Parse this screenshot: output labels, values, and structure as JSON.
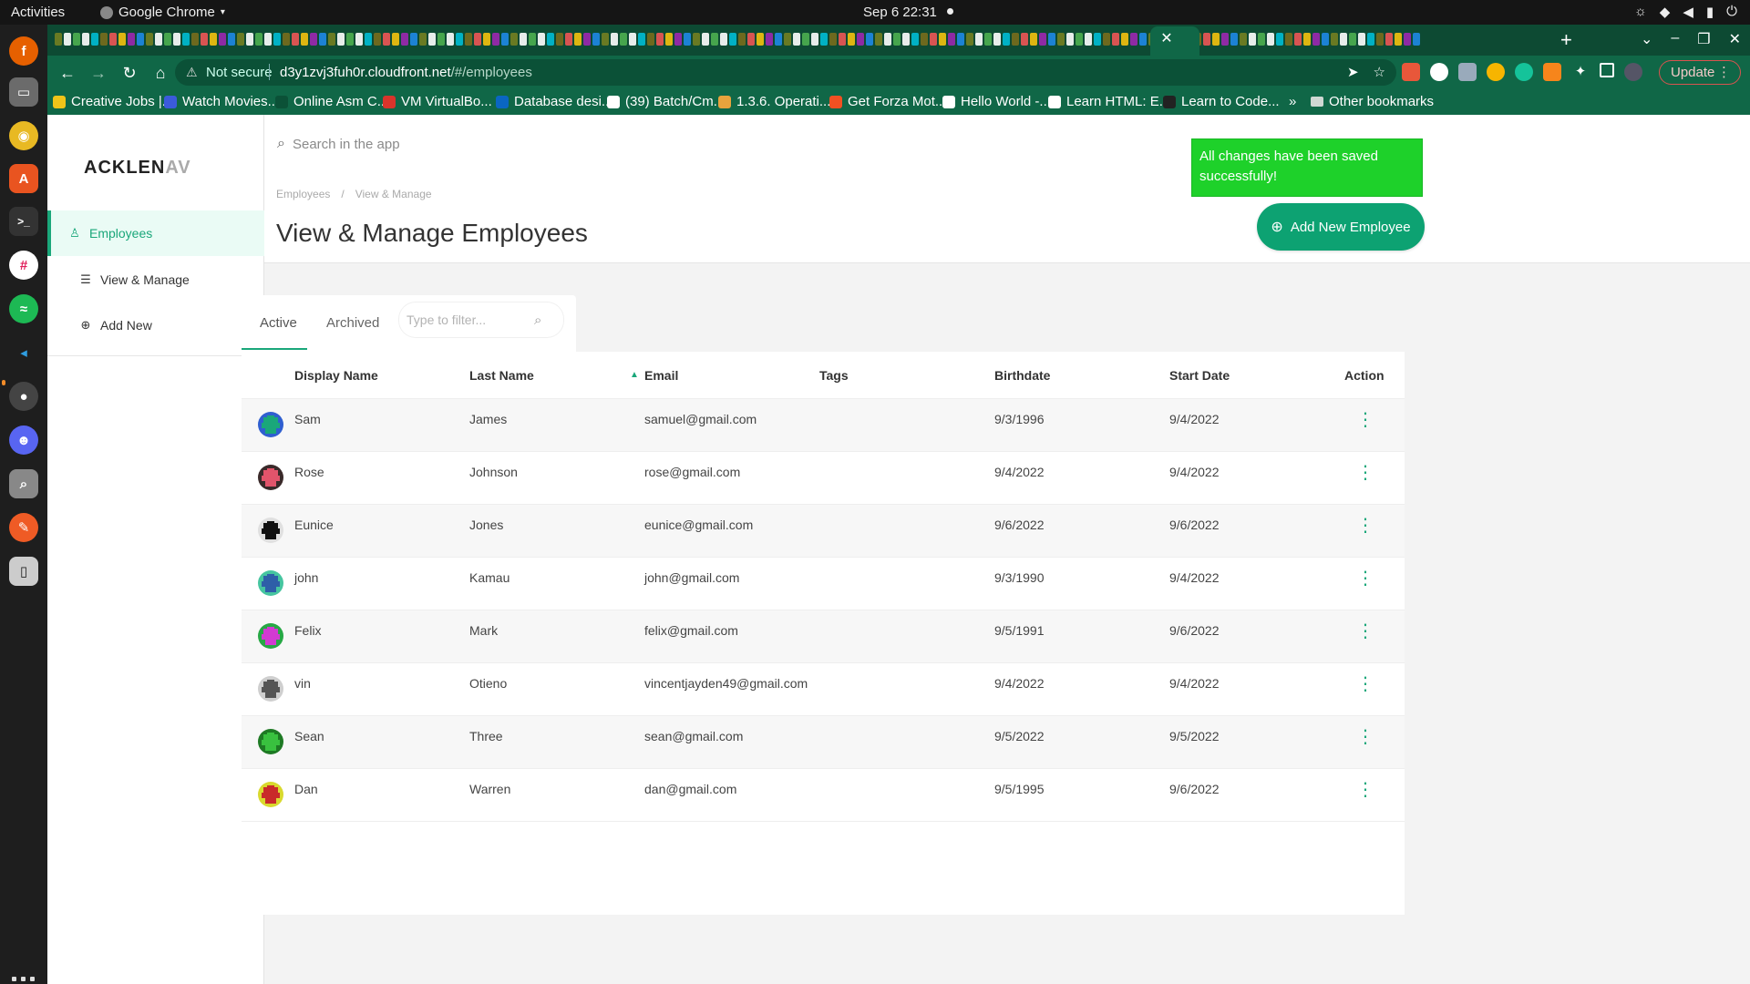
{
  "system": {
    "activities": "Activities",
    "app_name": "Google Chrome",
    "clock": "Sep 6  22:31"
  },
  "browser": {
    "url_warning": "Not secure",
    "url_host": "d3y1zvj3fuh0r.cloudfront.net",
    "url_path": "/#/employees",
    "update_label": "Update",
    "bookmarks": [
      {
        "label": "Creative Jobs |...",
        "color": "#f0c419"
      },
      {
        "label": "Watch Movies...",
        "color": "#3b5bdb"
      },
      {
        "label": "Online Asm C...",
        "color": "#0b5137"
      },
      {
        "label": "VM VirtualBo...",
        "color": "#d9342b"
      },
      {
        "label": "Database desi...",
        "color": "#0a66c2"
      },
      {
        "label": "(39) Batch/Cm...",
        "color": "#ffffff"
      },
      {
        "label": "1.3.6. Operati...",
        "color": "#e8a33d"
      },
      {
        "label": "Get Forza Mot...",
        "color": "#f25022"
      },
      {
        "label": "Hello World -...",
        "color": "#ffffff"
      },
      {
        "label": "Learn HTML: E...",
        "color": "#ffffff"
      },
      {
        "label": "Learn to Code...",
        "color": "#222222"
      }
    ],
    "bookmarks_overflow": "»",
    "other_bookmarks": "Other bookmarks"
  },
  "app": {
    "logo_main": "ACKLEN",
    "logo_fade": "AV",
    "search_placeholder": "Search in the app",
    "nav": {
      "employees": "Employees",
      "view_manage": "View & Manage",
      "add_new": "Add New"
    },
    "breadcrumb": [
      "Employees",
      "/",
      "View & Manage"
    ],
    "page_title": "View & Manage Employees",
    "toast": "All changes have been saved successfully!",
    "add_button": "Add New Employee",
    "tabs": {
      "active": "Active",
      "archived": "Archived"
    },
    "filter_placeholder": "Type to filter...",
    "columns": [
      "Display Name",
      "Last Name",
      "Email",
      "Tags",
      "Birthdate",
      "Start Date",
      "Action"
    ],
    "rows": [
      {
        "display": "Sam",
        "last": "James",
        "email": "samuel@gmail.com",
        "tags": "",
        "birth": "9/3/1996",
        "start": "9/4/2022",
        "c1": "#1aa77a",
        "c2": "#2f5fd0"
      },
      {
        "display": "Rose",
        "last": "Johnson",
        "email": "rose@gmail.com",
        "tags": "",
        "birth": "9/4/2022",
        "start": "9/4/2022",
        "c1": "#e2546b",
        "c2": "#3a2a2a"
      },
      {
        "display": "Eunice",
        "last": "Jones",
        "email": "eunice@gmail.com",
        "tags": "",
        "birth": "9/6/2022",
        "start": "9/6/2022",
        "c1": "#111111",
        "c2": "#e0e0e0"
      },
      {
        "display": "john",
        "last": "Kamau",
        "email": "john@gmail.com",
        "tags": "",
        "birth": "9/3/1990",
        "start": "9/4/2022",
        "c1": "#2e5fa8",
        "c2": "#46c5a0"
      },
      {
        "display": "Felix",
        "last": "Mark",
        "email": "felix@gmail.com",
        "tags": "",
        "birth": "9/5/1991",
        "start": "9/6/2022",
        "c1": "#d23ad2",
        "c2": "#27a845"
      },
      {
        "display": "vin",
        "last": "Otieno",
        "email": "vincentjayden49@gmail.com",
        "tags": "",
        "birth": "9/4/2022",
        "start": "9/4/2022",
        "c1": "#555555",
        "c2": "#cfcfcf"
      },
      {
        "display": "Sean",
        "last": "Three",
        "email": "sean@gmail.com",
        "tags": "",
        "birth": "9/5/2022",
        "start": "9/5/2022",
        "c1": "#39c13f",
        "c2": "#1e7a24"
      },
      {
        "display": "Dan",
        "last": "Warren",
        "email": "dan@gmail.com",
        "tags": "",
        "birth": "9/5/1995",
        "start": "9/6/2022",
        "c1": "#c92a2a",
        "c2": "#d9d92e"
      }
    ]
  },
  "colors": {
    "accent": "#1aa77a",
    "button": "#0da272",
    "toast": "#1ed12a",
    "chrome_frame": "#106747"
  }
}
